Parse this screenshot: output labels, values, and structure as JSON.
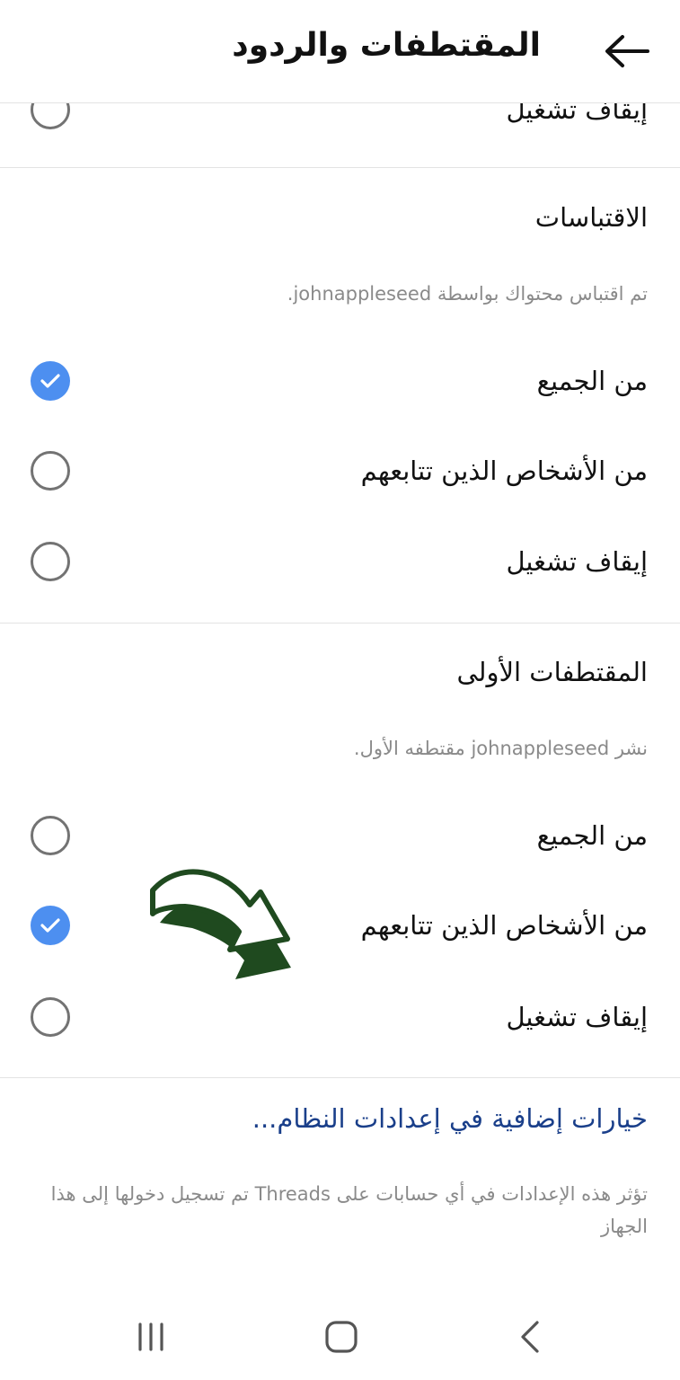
{
  "header": {
    "title": "المقتطفات والردود"
  },
  "top_partial_option": {
    "label": "إيقاف تشغيل",
    "selected": false
  },
  "quotes": {
    "title": "الاقتباسات",
    "description": "تم اقتباس محتواك بواسطة johnappleseed.",
    "options": [
      {
        "label": "من الجميع",
        "selected": true
      },
      {
        "label": "من الأشخاص الذين تتابعهم",
        "selected": false
      },
      {
        "label": "إيقاف تشغيل",
        "selected": false
      }
    ]
  },
  "first_threads": {
    "title": "المقتطفات الأولى",
    "description": "نشر johnappleseed مقتطفه الأول.",
    "options": [
      {
        "label": "من الجميع",
        "selected": false
      },
      {
        "label": "من الأشخاص الذين تتابعهم",
        "selected": true
      },
      {
        "label": "إيقاف تشغيل",
        "selected": false
      }
    ]
  },
  "system_settings_link": "خيارات إضافية في إعدادات النظام...",
  "footer_note": "تؤثر هذه الإعدادات في أي حسابات على Threads تم تسجيل دخولها إلى هذا الجهاز",
  "colors": {
    "accent": "#4d8ff0",
    "link": "#1a3f8a",
    "annotation_arrow": "#1f4a1f"
  },
  "icons": {
    "back": "back-arrow-icon",
    "check": "checkmark-icon",
    "annotation": "curved-arrow-icon",
    "nav_recents": "recents-icon",
    "nav_home": "home-icon",
    "nav_back": "nav-back-icon"
  }
}
